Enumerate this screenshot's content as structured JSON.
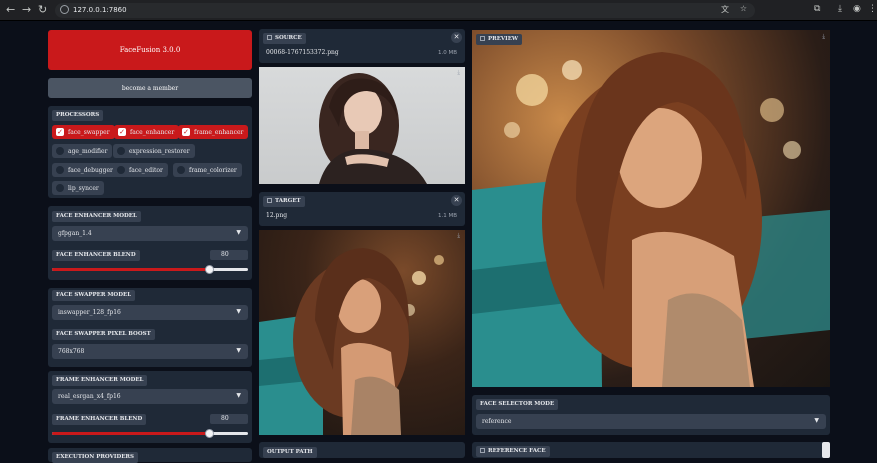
{
  "browser": {
    "url": "127.0.0.1:7860"
  },
  "app": {
    "title": "FaceFusion 3.0.0",
    "member_label": "become a member"
  },
  "processors": {
    "label": "PROCESSORS",
    "items": [
      {
        "label": "face_swapper",
        "checked": true
      },
      {
        "label": "face_enhancer",
        "checked": true
      },
      {
        "label": "frame_enhancer",
        "checked": true
      },
      {
        "label": "age_modifier",
        "checked": false
      },
      {
        "label": "expression_restorer",
        "checked": false
      },
      {
        "label": "face_debugger",
        "checked": false
      },
      {
        "label": "face_editor",
        "checked": false
      },
      {
        "label": "frame_colorizer",
        "checked": false
      },
      {
        "label": "lip_syncer",
        "checked": false
      }
    ]
  },
  "face_enhancer": {
    "model_label": "FACE ENHANCER MODEL",
    "model_value": "gfpgan_1.4",
    "blend_label": "FACE ENHANCER BLEND",
    "blend_value": "80",
    "blend_fraction": 0.8
  },
  "face_swapper": {
    "model_label": "FACE SWAPPER MODEL",
    "model_value": "inswapper_128_fp16",
    "boost_label": "FACE SWAPPER PIXEL BOOST",
    "boost_value": "768x768"
  },
  "frame_enhancer": {
    "model_label": "FRAME ENHANCER MODEL",
    "model_value": "real_esrgan_x4_fp16",
    "blend_label": "FRAME ENHANCER BLEND",
    "blend_value": "80",
    "blend_fraction": 0.8
  },
  "execution": {
    "label": "EXECUTION PROVIDERS"
  },
  "source": {
    "label": "SOURCE",
    "filename": "00068-1767153372.png",
    "size": "1.0 MB"
  },
  "target": {
    "label": "TARGET",
    "filename": "12.png",
    "size": "1.1 MB"
  },
  "output": {
    "label": "OUTPUT PATH"
  },
  "preview": {
    "label": "PREVIEW"
  },
  "face_selector": {
    "label": "FACE SELECTOR MODE",
    "value": "reference"
  },
  "reference_face": {
    "label": "REFERENCE FACE"
  },
  "icons": [
    "back-icon",
    "forward-icon",
    "reload-icon",
    "translate-icon",
    "star-icon",
    "extensions-icon",
    "download-icon",
    "profile-icon",
    "menu-icon",
    "close-icon",
    "download-icon",
    "file-icon",
    "dropdown-arrow-icon"
  ],
  "colors": {
    "accent": "#c9191b",
    "panel": "#1f2937",
    "input": "#374151",
    "bg": "#0b0f19"
  }
}
